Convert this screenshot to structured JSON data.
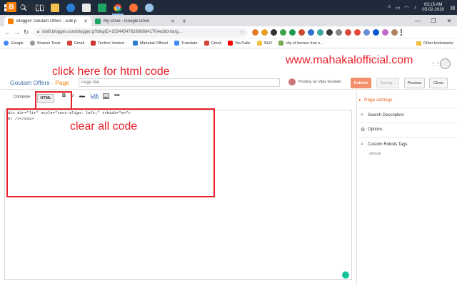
{
  "taskbar": {
    "clock_time": "03:15 AM",
    "clock_date": "05-02-2020",
    "icons": [
      "windows-start-icon",
      "search-icon",
      "task-view-icon",
      "file-explorer-icon",
      "edge-icon",
      "store-icon",
      "sheets-icon",
      "chrome-icon",
      "firefox-icon",
      "paint-icon"
    ]
  },
  "tabs": [
    {
      "title": "Blogger: Goutam Offers - Edit p",
      "active": true
    },
    {
      "title": "My Drive - Google Drive",
      "active": false
    }
  ],
  "toolbar": {
    "url": "draft.blogger.com/blogger.g?blogID=1034454762808864170#editor/targ..."
  },
  "bookmarks": {
    "items": [
      "Google",
      "Shanes Tools",
      "Gmail",
      "Techno Vedant -",
      "Mahakal Official",
      "Translate",
      "Gmail",
      "YouTube",
      "SEO",
      "city of heroes free s..."
    ],
    "other": "Other bookmarks"
  },
  "app": {
    "name": "Blogger",
    "blog_title": "Goutam Offers",
    "crumb_sep": "·",
    "page_label": "Page",
    "page_title_placeholder": "Page title",
    "posting_as": "Posting as Vijay Goutam",
    "publish": "Publish",
    "saving": "Saving...",
    "preview": "Preview",
    "close": "Close"
  },
  "editor": {
    "compose": "Compose",
    "html": "HTML",
    "bold": "B",
    "italic": "I",
    "strike": "abc",
    "link": "Link",
    "quote": "❝❝",
    "code_line1": "div dir=\"ltr\" style=\"text-align: left;\" trbidi=\"on\">",
    "code_line2": "br /></div>"
  },
  "annotations": {
    "click_html": "click here for html code",
    "clear_code": "clear all code",
    "watermark": "www.mahakalofficial.com"
  },
  "sidebar": {
    "heading": "Page settings",
    "search_description": "Search Description",
    "options": "Options",
    "custom_robots": "Custom Robots Tags",
    "robots_value": "default"
  }
}
